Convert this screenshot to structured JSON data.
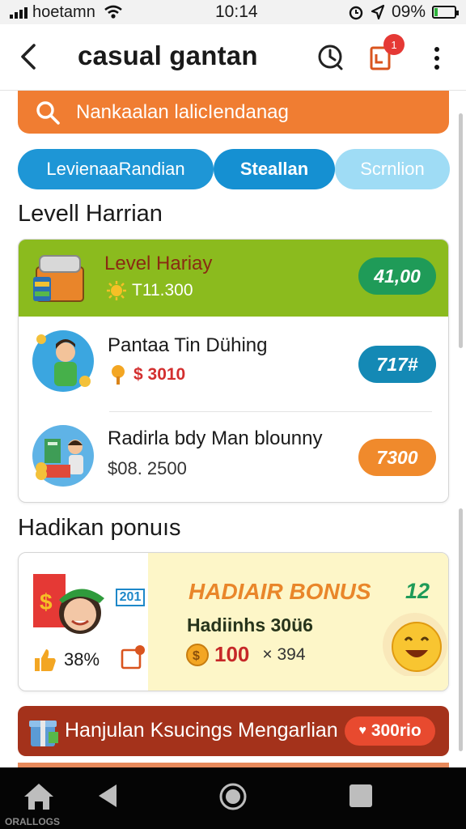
{
  "status_bar": {
    "carrier": "hoetamn",
    "time": "10:14",
    "battery": "09%",
    "battery_level": 0.09
  },
  "header": {
    "back_icon": "back-arrow-icon",
    "title": "casual gantan",
    "notification_count": "1"
  },
  "search": {
    "placeholder": "Nankaalan lalicIendanag"
  },
  "tabs": [
    {
      "label": "LevienaaRandian"
    },
    {
      "label": "Steallan"
    },
    {
      "label": "Scrnlion"
    }
  ],
  "sections": {
    "level_title": "Levell Harrian",
    "bonus_title": "Hadikan ponuıs"
  },
  "level_items": [
    {
      "title": "Level Hariay",
      "sub_value": "T11.300",
      "pill": "41,00",
      "pill_color": "#1f9b58",
      "icon": "treasure-chest-icon"
    },
    {
      "title": "Pantaa Tin Dühing",
      "sub_value": "$ 3010",
      "pill": "717#",
      "pill_color": "#1489b5",
      "icon": "character-boy-icon"
    },
    {
      "title": "Radirla bdy Man blounny",
      "sub_value": "$08. 2500",
      "pill": "7300",
      "pill_color": "#f08a2c",
      "icon": "shop-cash-icon"
    }
  ],
  "bonus": {
    "badge": "201",
    "heading": "HADIAIR BONUS",
    "corner_value": "12",
    "subheading": "Hadiinhs 30ü6",
    "amount": "100",
    "multiplier": "× 394",
    "like_percent": "38%",
    "icon": "smiley-face-icon"
  },
  "banner": {
    "text": "Hanjulan Ksucings Mengarlian",
    "pill": "300rio"
  },
  "nav": {
    "caption": "ORALLOGS"
  }
}
